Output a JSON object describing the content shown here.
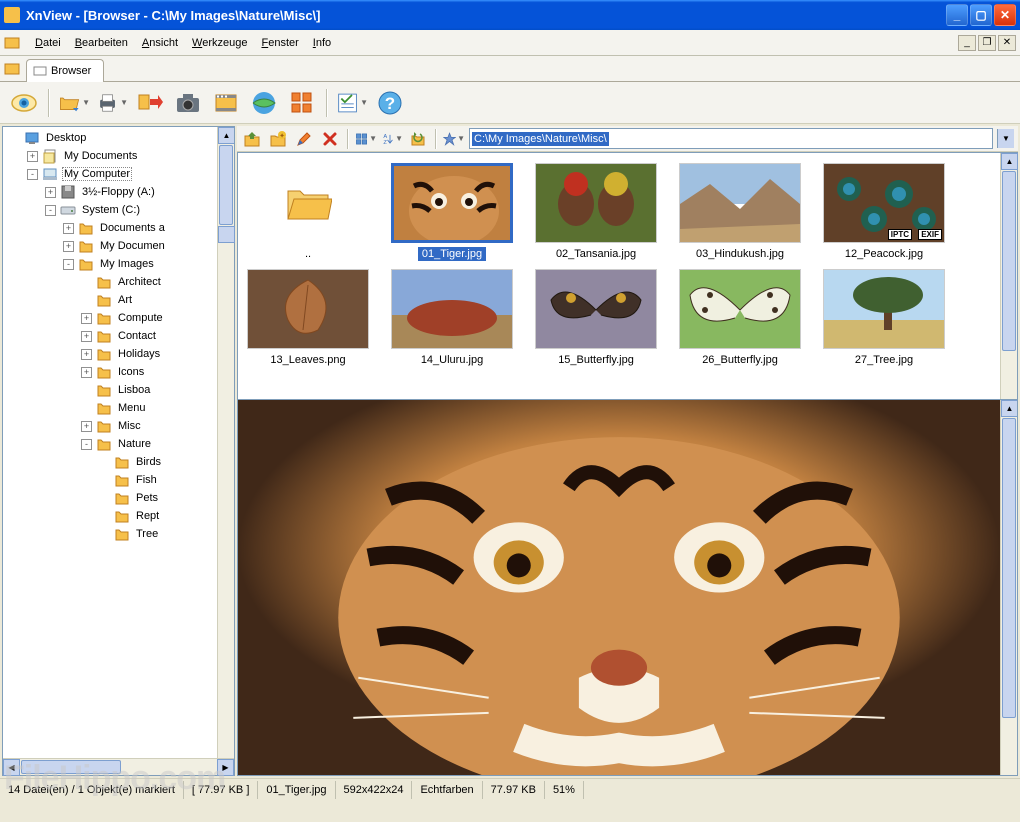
{
  "title": "XnView - [Browser - C:\\My Images\\Nature\\Misc\\]",
  "menu": [
    "Datei",
    "Bearbeiten",
    "Ansicht",
    "Werkzeuge",
    "Fenster",
    "Info"
  ],
  "tab": {
    "label": "Browser"
  },
  "address": "C:\\My Images\\Nature\\Misc\\",
  "tree": [
    {
      "depth": 0,
      "expand": "",
      "icon": "desktop",
      "label": "Desktop"
    },
    {
      "depth": 1,
      "expand": "+",
      "icon": "mydocs",
      "label": "My Documents"
    },
    {
      "depth": 1,
      "expand": "-",
      "icon": "computer",
      "label": "My Computer",
      "selected": true
    },
    {
      "depth": 2,
      "expand": "+",
      "icon": "floppy",
      "label": "3½-Floppy (A:)"
    },
    {
      "depth": 2,
      "expand": "-",
      "icon": "drive",
      "label": "System (C:)"
    },
    {
      "depth": 3,
      "expand": "+",
      "icon": "folder",
      "label": "Documents a"
    },
    {
      "depth": 3,
      "expand": "+",
      "icon": "folder",
      "label": "My Documen"
    },
    {
      "depth": 3,
      "expand": "-",
      "icon": "folder",
      "label": "My Images"
    },
    {
      "depth": 4,
      "expand": "",
      "icon": "folder",
      "label": "Architect"
    },
    {
      "depth": 4,
      "expand": "",
      "icon": "folder",
      "label": "Art"
    },
    {
      "depth": 4,
      "expand": "+",
      "icon": "folder",
      "label": "Compute"
    },
    {
      "depth": 4,
      "expand": "+",
      "icon": "folder",
      "label": "Contact"
    },
    {
      "depth": 4,
      "expand": "+",
      "icon": "folder",
      "label": "Holidays"
    },
    {
      "depth": 4,
      "expand": "+",
      "icon": "folder",
      "label": "Icons"
    },
    {
      "depth": 4,
      "expand": "",
      "icon": "folder",
      "label": "Lisboa"
    },
    {
      "depth": 4,
      "expand": "",
      "icon": "folder",
      "label": "Menu"
    },
    {
      "depth": 4,
      "expand": "+",
      "icon": "folder",
      "label": "Misc"
    },
    {
      "depth": 4,
      "expand": "-",
      "icon": "folder",
      "label": "Nature"
    },
    {
      "depth": 5,
      "expand": "",
      "icon": "folder",
      "label": "Birds"
    },
    {
      "depth": 5,
      "expand": "",
      "icon": "folder",
      "label": "Fish"
    },
    {
      "depth": 5,
      "expand": "",
      "icon": "folder",
      "label": "Pets"
    },
    {
      "depth": 5,
      "expand": "",
      "icon": "folder",
      "label": "Rept"
    },
    {
      "depth": 5,
      "expand": "",
      "icon": "folder",
      "label": "Tree"
    }
  ],
  "thumbs": [
    {
      "type": "folder",
      "label": ".."
    },
    {
      "type": "img",
      "label": "01_Tiger.jpg",
      "selected": true,
      "kind": "tiger"
    },
    {
      "type": "img",
      "label": "02_Tansania.jpg",
      "kind": "people"
    },
    {
      "type": "img",
      "label": "03_Hindukush.jpg",
      "kind": "mountain"
    },
    {
      "type": "img",
      "label": "12_Peacock.jpg",
      "kind": "peacock",
      "badges": [
        "EXIF",
        "IPTC"
      ]
    },
    {
      "type": "img",
      "label": "13_Leaves.png",
      "kind": "leaves"
    },
    {
      "type": "img",
      "label": "14_Uluru.jpg",
      "kind": "uluru"
    },
    {
      "type": "img",
      "label": "15_Butterfly.jpg",
      "kind": "butterfly1"
    },
    {
      "type": "img",
      "label": "26_Butterfly.jpg",
      "kind": "butterfly2"
    },
    {
      "type": "img",
      "label": "27_Tree.jpg",
      "kind": "tree"
    }
  ],
  "status": {
    "files": "14 Datei(en) / 1 Objekt(e) markiert",
    "size1": "[ 77.97 KB ]",
    "filename": "01_Tiger.jpg",
    "dims": "592x422x24",
    "colors": "Echtfarben",
    "size2": "77.97 KB",
    "zoom": "51%"
  },
  "watermark": "FileHippo.com"
}
